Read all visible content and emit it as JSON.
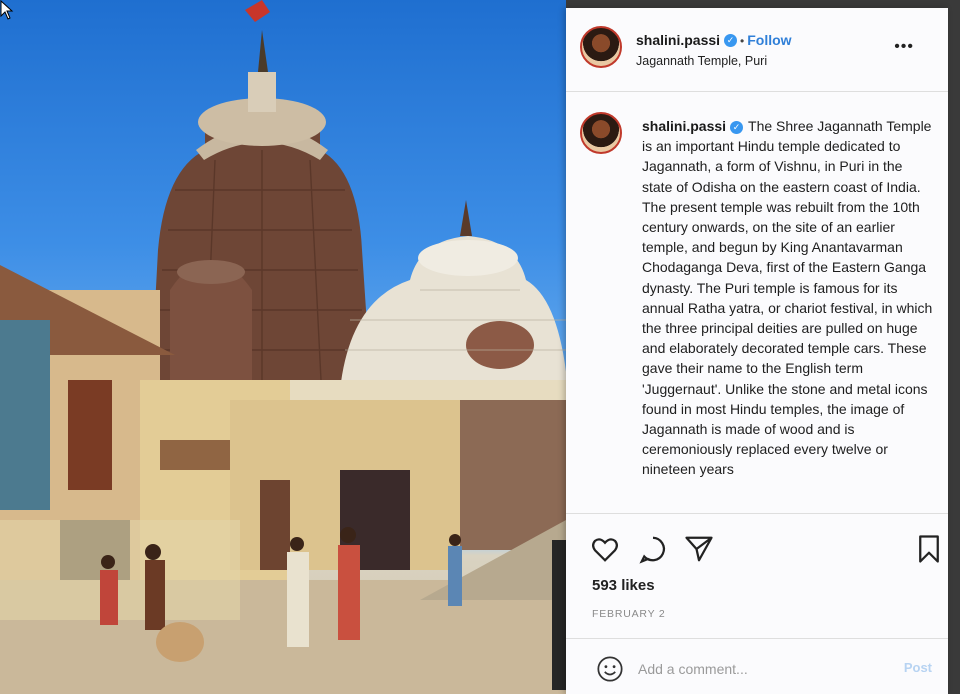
{
  "post": {
    "username": "shalini.passi",
    "verified_icon": "verified-badge-icon",
    "follow_separator": "•",
    "follow_label": "Follow",
    "location": "Jagannath Temple, Puri",
    "more_icon": "more-options-icon",
    "caption": "The Shree Jagannath Temple is an important Hindu temple dedicated to Jagannath, a form of Vishnu, in Puri in the state of Odisha on the eastern coast of India. The present temple was rebuilt from the 10th century onwards, on the site of an earlier temple, and begun by King Anantavarman Chodaganga Deva, first of the Eastern Ganga dynasty. The Puri temple is famous for its annual Ratha yatra, or chariot festival, in which the three principal deities are pulled on huge and elaborately decorated temple cars. These gave their name to the English term 'Juggernaut'. Unlike the stone and metal icons found in most Hindu temples, the image of Jagannath is made of wood and is ceremoniously replaced every twelve or nineteen years",
    "likes": "593 likes",
    "date": "FEBRUARY 2",
    "comment_placeholder": "Add a comment...",
    "post_label": "Post"
  },
  "icons": {
    "like": "heart-icon",
    "comment": "comment-icon",
    "share": "share-icon",
    "save": "bookmark-icon",
    "emoji": "emoji-icon"
  },
  "colors": {
    "follow": "#2f7fd8",
    "verified": "#3897f0",
    "post_disabled": "#b7d3f2"
  }
}
